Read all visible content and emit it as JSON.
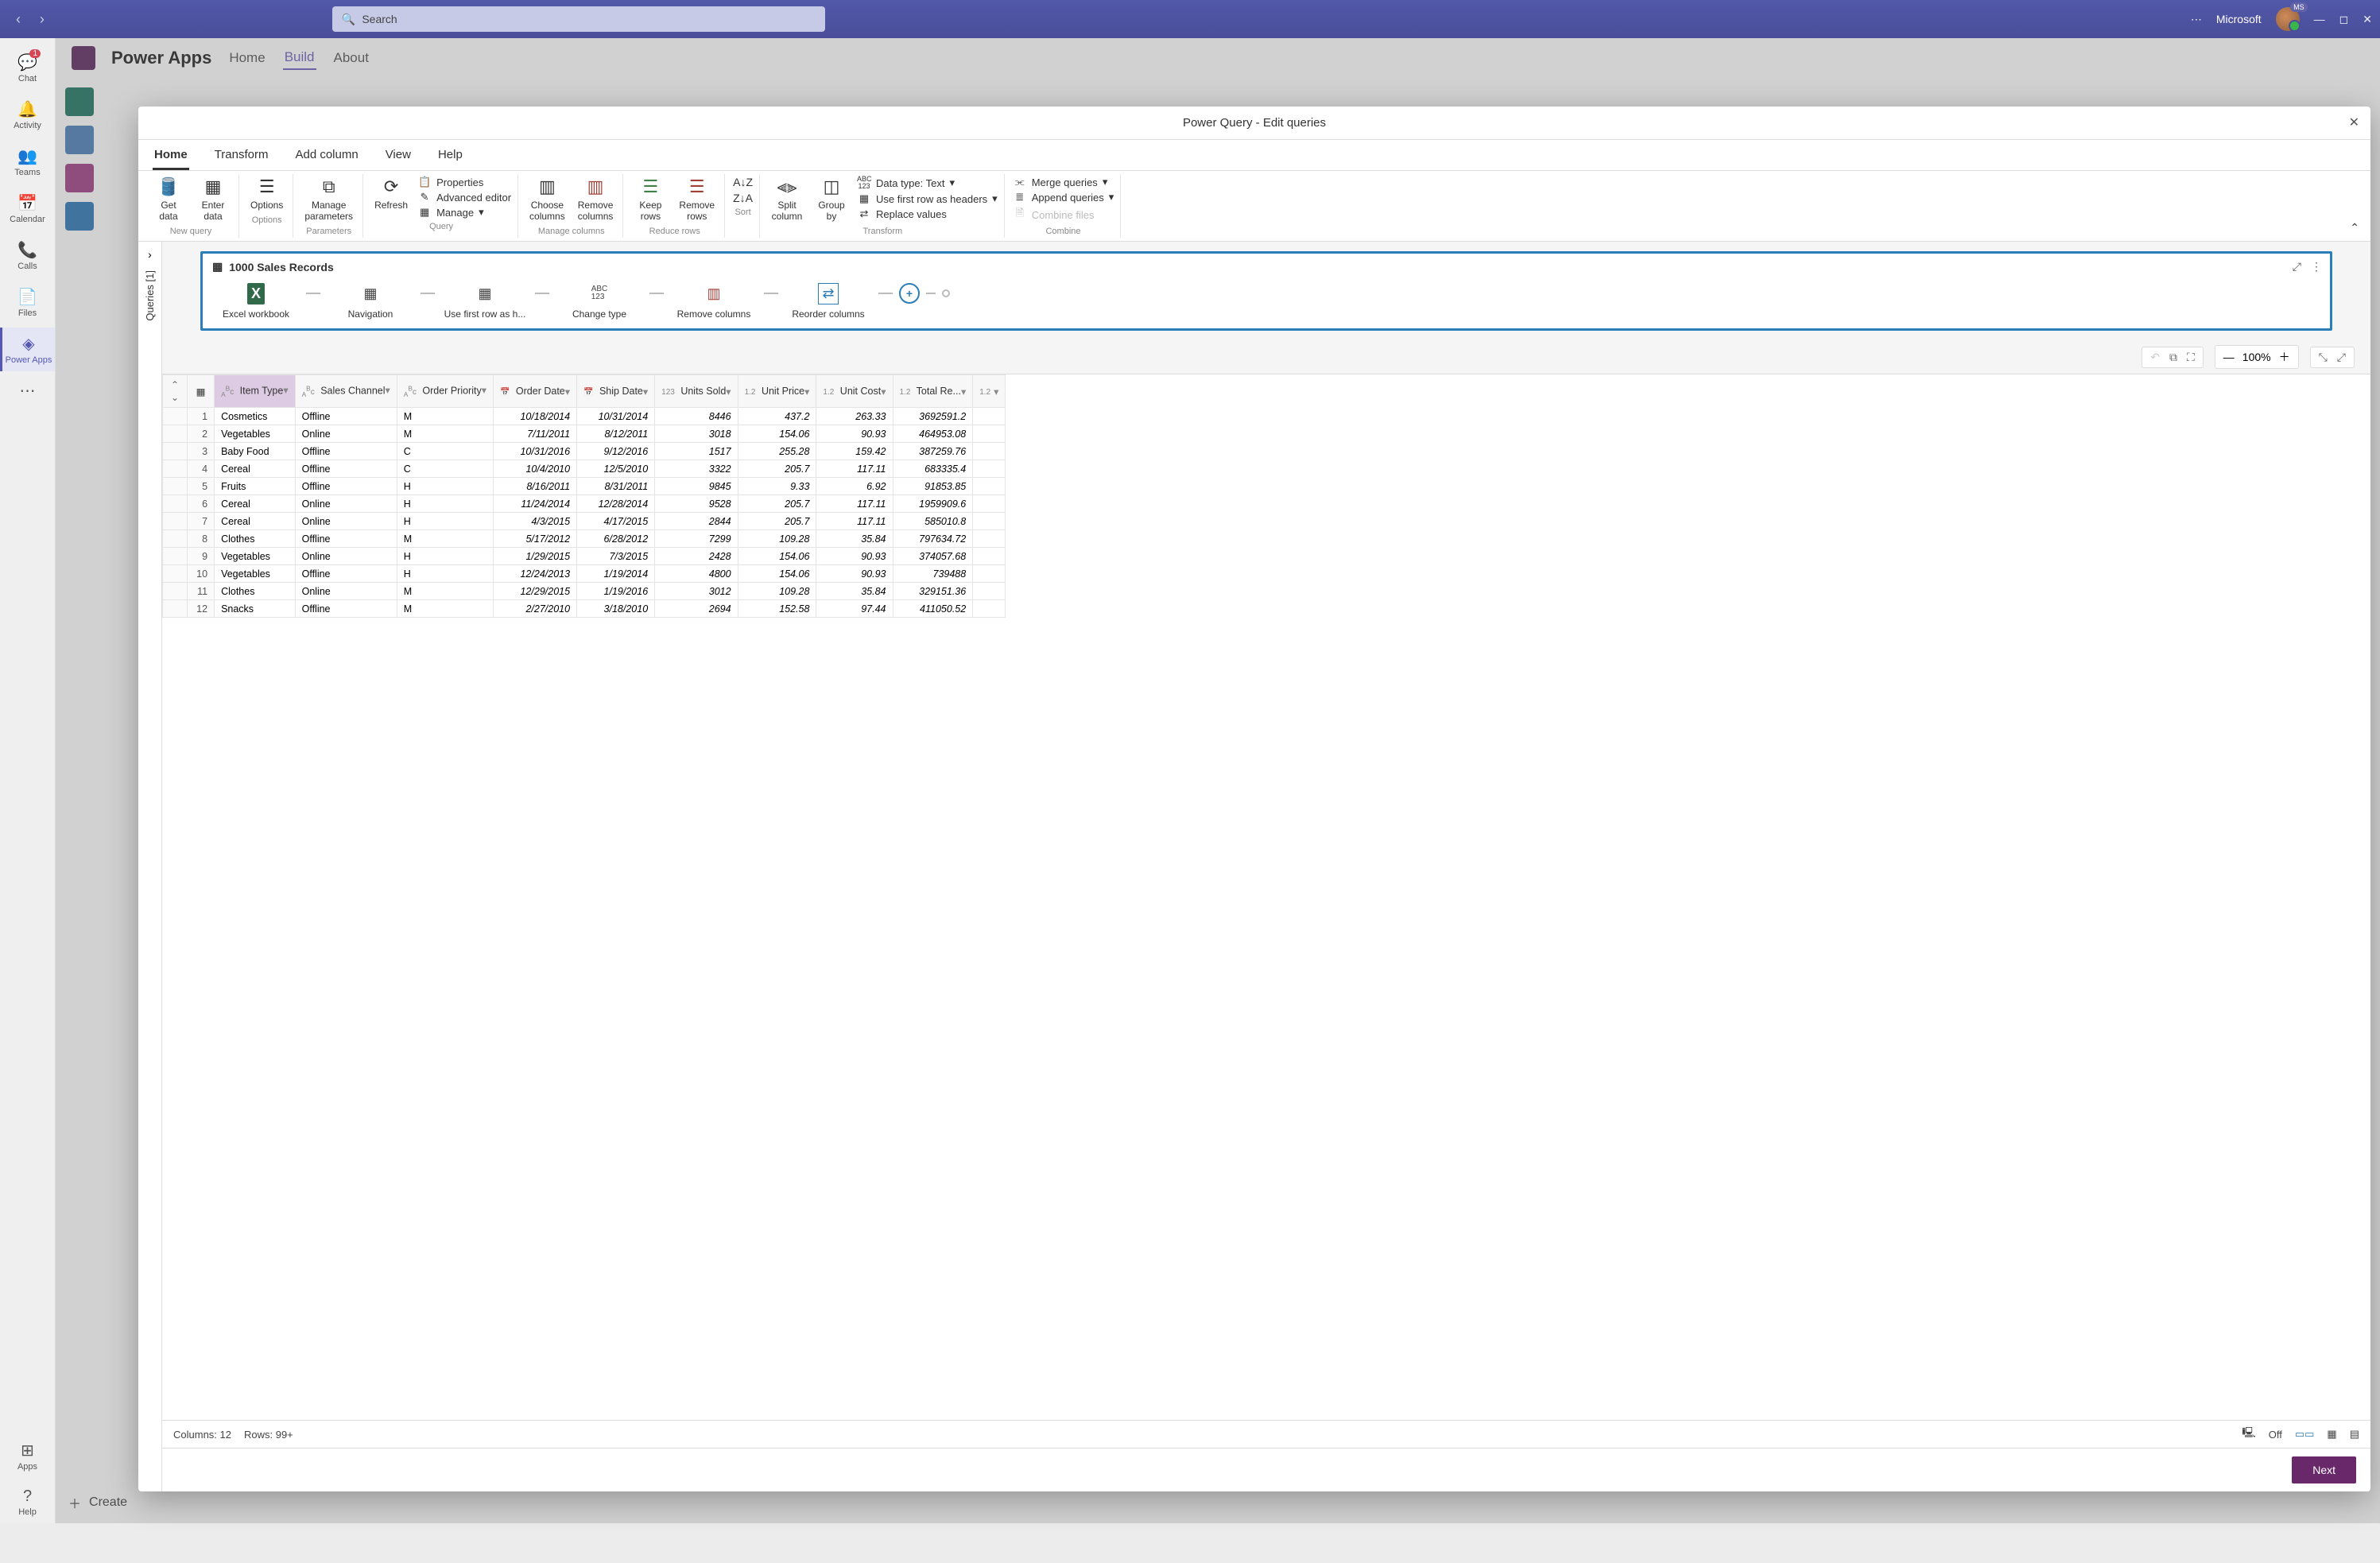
{
  "titlebar": {
    "search_placeholder": "Search",
    "org": "Microsoft"
  },
  "sidebar": {
    "items": [
      {
        "label": "Chat",
        "icon": "💬",
        "badge": "1"
      },
      {
        "label": "Activity",
        "icon": "🔔"
      },
      {
        "label": "Teams",
        "icon": "👥"
      },
      {
        "label": "Calendar",
        "icon": "📅"
      },
      {
        "label": "Calls",
        "icon": "📞"
      },
      {
        "label": "Files",
        "icon": "📄"
      },
      {
        "label": "Power Apps",
        "icon": "◈",
        "active": true
      },
      {
        "label": "",
        "icon": "⋯"
      }
    ],
    "bottom": [
      {
        "label": "Apps",
        "icon": "⊞"
      },
      {
        "label": "Help",
        "icon": "?"
      }
    ]
  },
  "bg_app": {
    "name": "Power Apps",
    "tabs": [
      "Home",
      "Build",
      "About"
    ],
    "active_tab": "Build",
    "create": "Create"
  },
  "modal": {
    "title": "Power Query - Edit queries",
    "tabs": [
      "Home",
      "Transform",
      "Add column",
      "View",
      "Help"
    ],
    "active_tab": "Home",
    "ribbon": {
      "new_query": {
        "label": "New query",
        "get_data": "Get\ndata",
        "enter_data": "Enter\ndata"
      },
      "options": {
        "label": "Options",
        "options": "Options"
      },
      "parameters": {
        "label": "Parameters",
        "manage": "Manage\nparameters"
      },
      "query": {
        "label": "Query",
        "refresh": "Refresh",
        "properties": "Properties",
        "advanced": "Advanced editor",
        "manage": "Manage"
      },
      "manage_columns": {
        "label": "Manage columns",
        "choose": "Choose\ncolumns",
        "remove": "Remove\ncolumns"
      },
      "reduce_rows": {
        "label": "Reduce rows",
        "keep": "Keep\nrows",
        "remove": "Remove\nrows"
      },
      "sort": {
        "label": "Sort"
      },
      "transform": {
        "label": "Transform",
        "split": "Split\ncolumn",
        "group": "Group\nby",
        "datatype": "Data type: Text",
        "first_row": "Use first row as headers",
        "replace": "Replace values"
      },
      "combine": {
        "label": "Combine",
        "merge": "Merge queries",
        "append": "Append queries",
        "files": "Combine files"
      }
    },
    "queries_label": "Queries [1]",
    "query_name": "1000 Sales Records",
    "steps": [
      {
        "label": "Excel workbook",
        "icon": "excel"
      },
      {
        "label": "Navigation",
        "icon": "table"
      },
      {
        "label": "Use first row as h...",
        "icon": "table"
      },
      {
        "label": "Change type",
        "icon": "type"
      },
      {
        "label": "Remove columns",
        "icon": "remcol"
      },
      {
        "label": "Reorder columns",
        "icon": "reorder"
      }
    ],
    "zoom": "100%",
    "status": {
      "columns": "Columns: 12",
      "rows": "Rows: 99+",
      "switch": "Off"
    },
    "next": "Next"
  },
  "table": {
    "columns": [
      {
        "name": "Item Type",
        "type": "ABC",
        "selected": true,
        "align": "left"
      },
      {
        "name": "Sales Channel",
        "type": "ABC",
        "align": "left"
      },
      {
        "name": "Order Priority",
        "type": "ABC",
        "align": "left"
      },
      {
        "name": "Order Date",
        "type": "DATE",
        "align": "right"
      },
      {
        "name": "Ship Date",
        "type": "DATE",
        "align": "right"
      },
      {
        "name": "Units Sold",
        "type": "123",
        "align": "right"
      },
      {
        "name": "Unit Price",
        "type": "1.2",
        "align": "right"
      },
      {
        "name": "Unit Cost",
        "type": "1.2",
        "align": "right"
      },
      {
        "name": "Total Re...",
        "type": "1.2",
        "align": "right"
      },
      {
        "name": "",
        "type": "1.2",
        "align": "right"
      }
    ],
    "rows": [
      [
        "Cosmetics",
        "Offline",
        "M",
        "10/18/2014",
        "10/31/2014",
        "8446",
        "437.2",
        "263.33",
        "3692591.2"
      ],
      [
        "Vegetables",
        "Online",
        "M",
        "7/11/2011",
        "8/12/2011",
        "3018",
        "154.06",
        "90.93",
        "464953.08"
      ],
      [
        "Baby Food",
        "Offline",
        "C",
        "10/31/2016",
        "9/12/2016",
        "1517",
        "255.28",
        "159.42",
        "387259.76"
      ],
      [
        "Cereal",
        "Offline",
        "C",
        "10/4/2010",
        "12/5/2010",
        "3322",
        "205.7",
        "117.11",
        "683335.4"
      ],
      [
        "Fruits",
        "Offline",
        "H",
        "8/16/2011",
        "8/31/2011",
        "9845",
        "9.33",
        "6.92",
        "91853.85"
      ],
      [
        "Cereal",
        "Online",
        "H",
        "11/24/2014",
        "12/28/2014",
        "9528",
        "205.7",
        "117.11",
        "1959909.6"
      ],
      [
        "Cereal",
        "Online",
        "H",
        "4/3/2015",
        "4/17/2015",
        "2844",
        "205.7",
        "117.11",
        "585010.8"
      ],
      [
        "Clothes",
        "Offline",
        "M",
        "5/17/2012",
        "6/28/2012",
        "7299",
        "109.28",
        "35.84",
        "797634.72"
      ],
      [
        "Vegetables",
        "Online",
        "H",
        "1/29/2015",
        "7/3/2015",
        "2428",
        "154.06",
        "90.93",
        "374057.68"
      ],
      [
        "Vegetables",
        "Offline",
        "H",
        "12/24/2013",
        "1/19/2014",
        "4800",
        "154.06",
        "90.93",
        "739488"
      ],
      [
        "Clothes",
        "Online",
        "M",
        "12/29/2015",
        "1/19/2016",
        "3012",
        "109.28",
        "35.84",
        "329151.36"
      ],
      [
        "Snacks",
        "Offline",
        "M",
        "2/27/2010",
        "3/18/2010",
        "2694",
        "152.58",
        "97.44",
        "411050.52"
      ]
    ]
  }
}
